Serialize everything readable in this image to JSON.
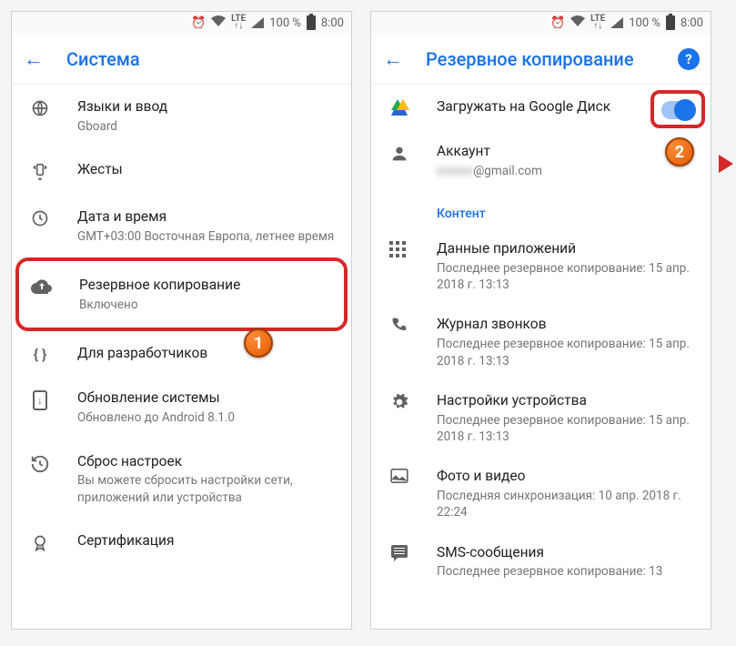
{
  "status": {
    "battery": "100 %",
    "time": "8:00"
  },
  "left": {
    "title": "Система",
    "items": [
      {
        "label": "Языки и ввод",
        "sub": "Gboard"
      },
      {
        "label": "Жесты",
        "sub": ""
      },
      {
        "label": "Дата и время",
        "sub": "GMT+03:00 Восточная Европа, летнее время"
      },
      {
        "label": "Резервное копирование",
        "sub": "Включено"
      },
      {
        "label": "Для разработчиков",
        "sub": ""
      },
      {
        "label": "Обновление системы",
        "sub": "Обновлено до Android 8.1.0"
      },
      {
        "label": "Сброс настроек",
        "sub": "Вы можете сбросить настройки сети, приложений или устройства"
      },
      {
        "label": "Сертификация",
        "sub": ""
      }
    ]
  },
  "right": {
    "title": "Резервное копирование",
    "upload_label": "Загружать на Google Диск",
    "account_label": "Аккаунт",
    "account_value": "@gmail.com",
    "section": "Контент",
    "items": [
      {
        "label": "Данные приложений",
        "sub": "Последнее резервное копирование: 15 апр. 2018 г. 13:13"
      },
      {
        "label": "Журнал звонков",
        "sub": "Последнее резервное копирование: 15 апр. 2018 г. 13:13"
      },
      {
        "label": "Настройки устройства",
        "sub": "Последнее резервное копирование: 15 апр. 2018 г. 13:13"
      },
      {
        "label": "Фото и видео",
        "sub": "Последняя синхронизация: 10 апр. 2018 г. 22:24"
      },
      {
        "label": "SMS-сообщения",
        "sub": "Последнее резервное копирование: 13"
      }
    ]
  },
  "badges": {
    "one": "1",
    "two": "2"
  }
}
